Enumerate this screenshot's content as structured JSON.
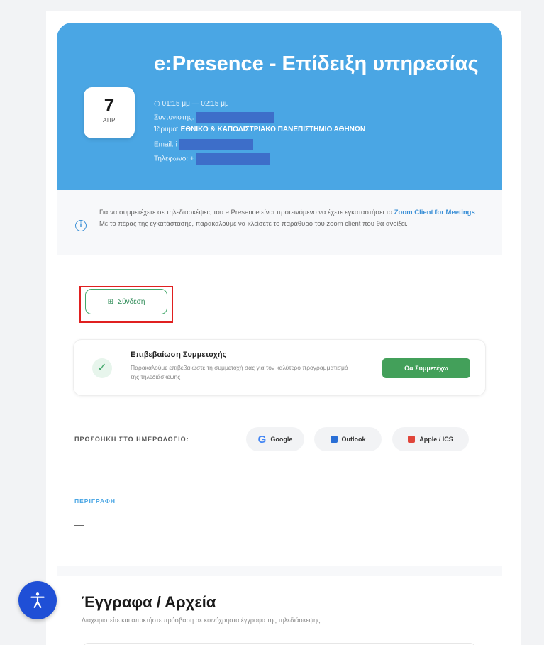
{
  "event": {
    "day": "7",
    "month": "ΑΠΡ",
    "title": "e:Presence - Επίδειξη υπηρεσίας",
    "time": "01:15 μμ — 02:15 μμ",
    "coordinator_label": "Συντονιστής:",
    "institution_label": "Ίδρυμα:",
    "institution_value": "ΕΘΝΙΚΟ & ΚΑΠΟΔΙΣΤΡΙΑΚΟ ΠΑΝΕΠΙΣΤΗΜΙΟ ΑΘΗΝΩΝ",
    "email_label": "Email:",
    "email_visible_prefix": "i",
    "phone_label": "Τηλέφωνο:",
    "phone_visible_prefix": "+"
  },
  "info": {
    "text_before": "Για να συμμετέχετε σε τηλεδιασκέψεις του e:Presence είναι προτεινόμενο να έχετε εγκαταστήσει το ",
    "link": "Zoom Client for Meetings",
    "text_after": ". Με το πέρας της εγκατάστασης, παρακαλούμε να κλείσετε το παράθυρο του zoom client που θα ανοίξει."
  },
  "connect": {
    "label": "Σύνδεση"
  },
  "confirmation": {
    "title": "Επιβεβαίωση Συμμετοχής",
    "description": "Παρακαλούμε επιβεβαιώστε τη συμμετοχή σας για τον καλύτερο προγραμματισμό της τηλεδιάσκεψης",
    "button": "Θα Συμμετέχω"
  },
  "calendar": {
    "label": "ΠΡΟΣΘΗΚΗ ΣΤΟ ΗΜΕΡΟΛΟΓΙΟ:",
    "google": "Google",
    "outlook": "Outlook",
    "apple": "Apple / ICS"
  },
  "description": {
    "label": "ΠΕΡΙΓΡΑΦΗ",
    "value": "—"
  },
  "documents": {
    "title": "Έγγραφα / Αρχεία",
    "subtitle": "Διαχειριστείτε και αποκτήστε πρόσβαση σε κοινόχρηστα έγγραφα της τηλεδιάσκεψης"
  },
  "colors": {
    "hero": "#4aa6e4",
    "accent_green": "#43a05a",
    "redaction": "#3d6ec9",
    "highlight_frame": "#e02020",
    "accessibility_button": "#1f4fd6"
  },
  "icons": {
    "time": "clock-icon",
    "info": "info-icon",
    "connect": "login-icon",
    "confirm": "check-circle-icon",
    "google": "google-icon",
    "outlook": "outlook-icon",
    "apple": "calendar-icon",
    "accessibility": "accessibility-icon"
  }
}
